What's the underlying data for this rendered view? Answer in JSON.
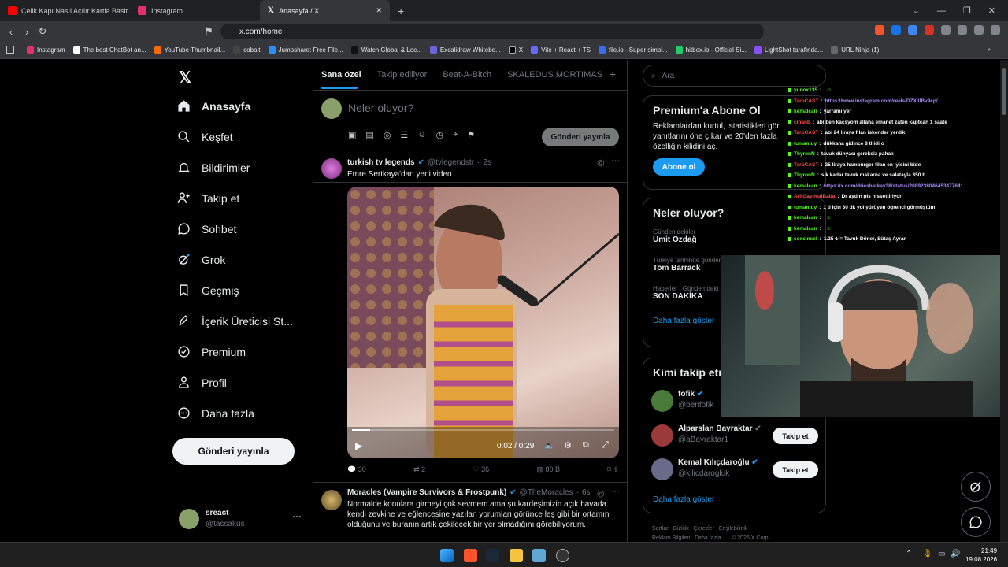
{
  "browser": {
    "tabs": [
      {
        "title": "Çelik Kapı Nasıl Açılır Kartla Basit Yön",
        "color": "#ff0000"
      },
      {
        "title": "Instagram",
        "color": "#e1306c"
      },
      {
        "title": "Anasayfa / X",
        "color": "#ffffff"
      }
    ],
    "url": "x.com/home",
    "bookmarks": [
      {
        "label": "Instagram",
        "color": "#e1306c"
      },
      {
        "label": "The best ChatBot an...",
        "color": "#ffffff"
      },
      {
        "label": "YouTube Thumbnail...",
        "color": "#ff6a00"
      },
      {
        "label": "cobalt",
        "color": "#444444"
      },
      {
        "label": "Jumpshare: Free File...",
        "color": "#2d8cff"
      },
      {
        "label": "Watch Global & Loc...",
        "color": "#111111"
      },
      {
        "label": "Excalidraw Whitebo...",
        "color": "#6965db"
      },
      {
        "label": "X",
        "color": "#000000"
      },
      {
        "label": "Vite + React + TS",
        "color": "#646cff"
      },
      {
        "label": "file.io - Super simpl...",
        "color": "#3a6df0"
      },
      {
        "label": "hitbox.io - Official Si...",
        "color": "#22cc66"
      },
      {
        "label": "LightShot tarafında...",
        "color": "#8a4fff"
      },
      {
        "label": "URL Ninja (1)",
        "color": "#666666"
      }
    ]
  },
  "nav": {
    "items": [
      {
        "label": "Anasayfa",
        "icon": "home-icon"
      },
      {
        "label": "Keşfet",
        "icon": "search-icon"
      },
      {
        "label": "Bildirimler",
        "icon": "bell-icon"
      },
      {
        "label": "Takip et",
        "icon": "person-add-icon"
      },
      {
        "label": "Sohbet",
        "icon": "chat-icon"
      },
      {
        "label": "Grok",
        "icon": "grok-icon"
      },
      {
        "label": "Geçmiş",
        "icon": "bookmark-icon"
      },
      {
        "label": "İçerik Üreticisi St...",
        "icon": "rocket-icon"
      },
      {
        "label": "Premium",
        "icon": "verified-icon"
      },
      {
        "label": "Profil",
        "icon": "profile-icon"
      },
      {
        "label": "Daha fazla",
        "icon": "more-circle-icon"
      }
    ],
    "post_button": "Gönderi yayınla",
    "profile": {
      "name": "sreact",
      "handle": "@tassakus"
    }
  },
  "feed": {
    "tabs": [
      "Sana özel",
      "Takip ediliyor",
      "Beat-A-Bitch",
      "SKALEDUS MORTIMAS"
    ],
    "compose_placeholder": "Neler oluyor?",
    "compose_button": "Gönderi yayınla",
    "tweet1": {
      "name": "turkish tv legends",
      "handle": "@tvlegendstr",
      "time": "2s",
      "text": "Emre Sertkaya'dan yeni video",
      "video_time": "0:02 / 0:29",
      "video_progress": 0.07,
      "replies": "30",
      "retweets": "2",
      "likes": "36",
      "views": "80 B"
    },
    "tweet2": {
      "name": "Moracles (Vampire Survivors & Frostpunk)",
      "handle": "@TheMoracles",
      "time": "6s",
      "text": "Normalde konulara girmeyi çok sevmem ama şu kardeşimizin açık havada kendi zevkine ve eğlencesine yazılan yorumları görünce leş gibi bir ortamın olduğunu ve buranın artık çekilecek bir yer olmadığını görebiliyorum."
    }
  },
  "sidebar": {
    "search_placeholder": "Ara",
    "premium": {
      "title": "Premium'a Abone Ol",
      "text": "Reklamlardan kurtul, istatistikleri gör, yanıtlarını öne çıkar ve 20'den fazla özelliğin kilidini aç.",
      "button": "Abone ol"
    },
    "trends": {
      "title": "Neler oluyor?",
      "items": [
        {
          "category": "Gündemdekiler",
          "title": "Ümit Özdağ"
        },
        {
          "category": "Türkiye tarihinde gündem",
          "title": "Tom Barrack"
        },
        {
          "category": "Haberler · Gündemdeki",
          "title": "SON DAKİKA"
        }
      ],
      "more": "Daha fazla göster"
    },
    "who_to_follow": {
      "title": "Kimi takip etme",
      "items": [
        {
          "name": "fofik",
          "handle": "@benfofik",
          "button": ""
        },
        {
          "name": "Alparslan Bayraktar",
          "handle": "@aBayraktar1",
          "button": "Takip et"
        },
        {
          "name": "Kemal Kılıçdaroğlu",
          "handle": "@kilicdarogluk",
          "button": "Takip et"
        }
      ],
      "more": "Daha fazla göster"
    },
    "footer": [
      "Şartlar",
      "Gizlilik",
      "Çerezler",
      "Erişilebilirlik",
      "Reklam Bilgileri",
      "Daha fazla ...",
      "© 2026 X Corp."
    ]
  },
  "chat": [
    {
      "user": "yunox135",
      "msg": "",
      "color": "#53fc18"
    },
    {
      "user": "TaroCAST",
      "msg": "https://www.instagram.com/reels/DZXillBv9cp/",
      "color": "#ff4d4d"
    },
    {
      "user": "kemalcan",
      "msg": "yarramı yer",
      "color": "#53fc18"
    },
    {
      "user": "cihanb",
      "msg": "abi ben kaçsyom allaha emanet zaten kaptcan 1 saate",
      "color": "#ff4d4d"
    },
    {
      "user": "TaroCAST",
      "msg": "abi 24 liraya filan iskender yerdik",
      "color": "#ff4d4d"
    },
    {
      "user": "tumantuy",
      "msg": "dükkana gidince 8 tl idi o",
      "color": "#53fc18"
    },
    {
      "user": "ThyronN",
      "msg": "tavuk dünyası gereksiz pahalı",
      "color": "#53fc18"
    },
    {
      "user": "TaroCAST",
      "msg": "25 liraya hamburger filan en iyisini bide",
      "color": "#ff4d4d"
    },
    {
      "user": "ThyronN",
      "msg": "sık kadar tavuk makarna ve salatayla 350 tl",
      "color": "#53fc18"
    },
    {
      "user": "kemalcan",
      "msg": "https://x.com/driesberkay38/status/2089238046453477641",
      "color": "#53fc18"
    },
    {
      "user": "ArifGayimalBaba",
      "msg": "Dr aydın pis hissettiriyor",
      "color": "#ff4d4d"
    },
    {
      "user": "tumantuy",
      "msg": "1 tl için 30 dk yol yürüyen öğrenci görmüştüm",
      "color": "#53fc18"
    },
    {
      "user": "kemalcan",
      "msg": "",
      "color": "#53fc18"
    },
    {
      "user": "kemalcan",
      "msg": "",
      "color": "#53fc18"
    },
    {
      "user": "soxcinsel",
      "msg": "1.25 ₺ = Tavuk Döner, Sütaş Ayran",
      "color": "#53fc18"
    }
  ],
  "taskbar": {
    "time": "21:49",
    "date": "19.08.2026"
  }
}
